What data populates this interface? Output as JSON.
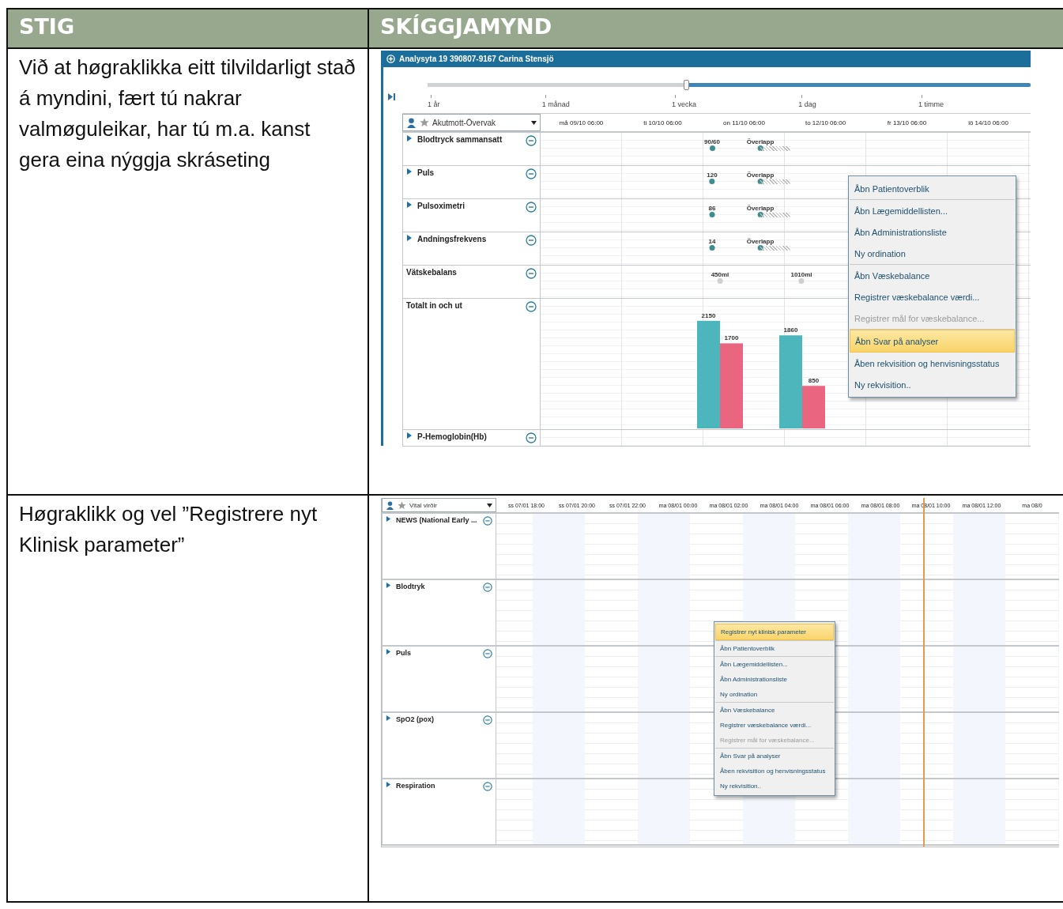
{
  "table": {
    "columns": [
      "STIG",
      "SKÍGGJAMYND"
    ],
    "rows": [
      {
        "step": "Við at høgraklikka eitt tilvildarligt stað á myndini, fært tú nakrar valmøguleikar, har tú m.a. kanst gera eina nýggja skráseting",
        "screenshot": {
          "kind": "analysis",
          "title": "Analysyta 19 390807-9167 Carina Stensjö",
          "zoom": {
            "level": 0.43,
            "labels": [
              "1 år",
              "1 månad",
              "1 vecka",
              "1 dag",
              "1 timme"
            ]
          },
          "view_select": "Akutmott-Övervak",
          "time_columns": [
            "må 09/10 06:00",
            "ti 10/10 06:00",
            "on 11/10 06:00",
            "to 12/10 06:00",
            "fr 13/10 06:00",
            "lö 14/10 06:00"
          ],
          "parameters": [
            {
              "name": "Blodtryck sammansatt",
              "expandable": true,
              "kind": "vital",
              "value": "90/60",
              "overlap": "Överlapp"
            },
            {
              "name": "Puls",
              "expandable": true,
              "kind": "vital",
              "value": "120",
              "overlap": "Överlapp"
            },
            {
              "name": "Pulsoximetri",
              "expandable": true,
              "kind": "vital",
              "value": "86",
              "overlap": "Överlapp"
            },
            {
              "name": "Andningsfrekvens",
              "expandable": true,
              "kind": "vital",
              "value": "14",
              "overlap": "Överlapp"
            },
            {
              "name": "Vätskebalans",
              "expandable": false,
              "kind": "fluid",
              "values": [
                "450ml",
                "1010ml"
              ]
            },
            {
              "name": "Totalt in och ut",
              "expandable": false,
              "kind": "chart",
              "chart_data": {
                "type": "bar",
                "data_labels": true,
                "series": [
                  {
                    "color": "#4db6bc",
                    "values": [
                      2150,
                      1860
                    ]
                  },
                  {
                    "color": "#ea6680",
                    "values": [
                      1700,
                      850
                    ]
                  }
                ]
              }
            },
            {
              "name": "P-Hemoglobin(Hb)",
              "expandable": true,
              "kind": "label"
            }
          ],
          "menu": [
            [
              {
                "label": "Åbn Patientoverblik",
                "selected": false,
                "disabled": false
              }
            ],
            [
              {
                "label": "Åbn  Lægemiddellisten...",
                "selected": false,
                "disabled": false
              },
              {
                "label": "Åbn Administrationsliste",
                "selected": false,
                "disabled": false
              },
              {
                "label": "Ny ordination",
                "selected": false,
                "disabled": false
              }
            ],
            [
              {
                "label": "Åbn Væskebalance",
                "selected": false,
                "disabled": false
              },
              {
                "label": "Registrer væskebalance værdi...",
                "selected": false,
                "disabled": false
              },
              {
                "label": "Registrer mål for væskebalance...",
                "selected": false,
                "disabled": true
              }
            ],
            [
              {
                "label": "Åbn Svar på analyser",
                "selected": true,
                "disabled": false
              },
              {
                "label": "Åben rekvisition og henvisningsstatus",
                "selected": false,
                "disabled": false
              },
              {
                "label": "Ny rekvisition..",
                "selected": false,
                "disabled": false
              }
            ]
          ]
        }
      },
      {
        "step": "Høgraklikk og vel ”Registrere nyt Klinisk parameter”",
        "screenshot": {
          "kind": "vitals",
          "view_select": "Vital virðir",
          "time_columns": [
            "ss 07/01 18:00",
            "ss 07/01 20:00",
            "ss 07/01 22:00",
            "ma 08/01 00:00",
            "ma 08/01 02:00",
            "ma 08/01 04:00",
            "ma 08/01 06:00",
            "ma 08/01 08:00",
            "ma 08/01 10:00",
            "ma 08/01 12:00",
            "ma 08/0"
          ],
          "parameters": [
            {
              "name": "NEWS (National Early ...",
              "expandable": true
            },
            {
              "name": "Blodtryk",
              "expandable": true
            },
            {
              "name": "Puls",
              "expandable": true
            },
            {
              "name": "SpO2 (pox)",
              "expandable": true
            },
            {
              "name": "Respiration",
              "expandable": true
            }
          ],
          "menu": [
            [
              {
                "label": "Registrer nyt klinisk parameter",
                "selected": true,
                "disabled": false
              }
            ],
            [
              {
                "label": "Åbn Patientoverblik",
                "selected": false,
                "disabled": false
              }
            ],
            [
              {
                "label": "Åbn  Lægemiddellisten...",
                "selected": false,
                "disabled": false
              },
              {
                "label": "Åbn Administrationsliste",
                "selected": false,
                "disabled": false
              },
              {
                "label": "Ny ordination",
                "selected": false,
                "disabled": false
              }
            ],
            [
              {
                "label": "Åbn Væskebalance",
                "selected": false,
                "disabled": false
              },
              {
                "label": "Registrer væskebalance værdi...",
                "selected": false,
                "disabled": false
              },
              {
                "label": "Registrer mål for væskebalance...",
                "selected": false,
                "disabled": true
              }
            ],
            [
              {
                "label": "Åbn Svar på analyser",
                "selected": false,
                "disabled": false
              },
              {
                "label": "Åben rekvisition og henvisningsstatus",
                "selected": false,
                "disabled": false
              },
              {
                "label": "Ny rekvisition..",
                "selected": false,
                "disabled": false
              }
            ]
          ]
        }
      }
    ]
  }
}
